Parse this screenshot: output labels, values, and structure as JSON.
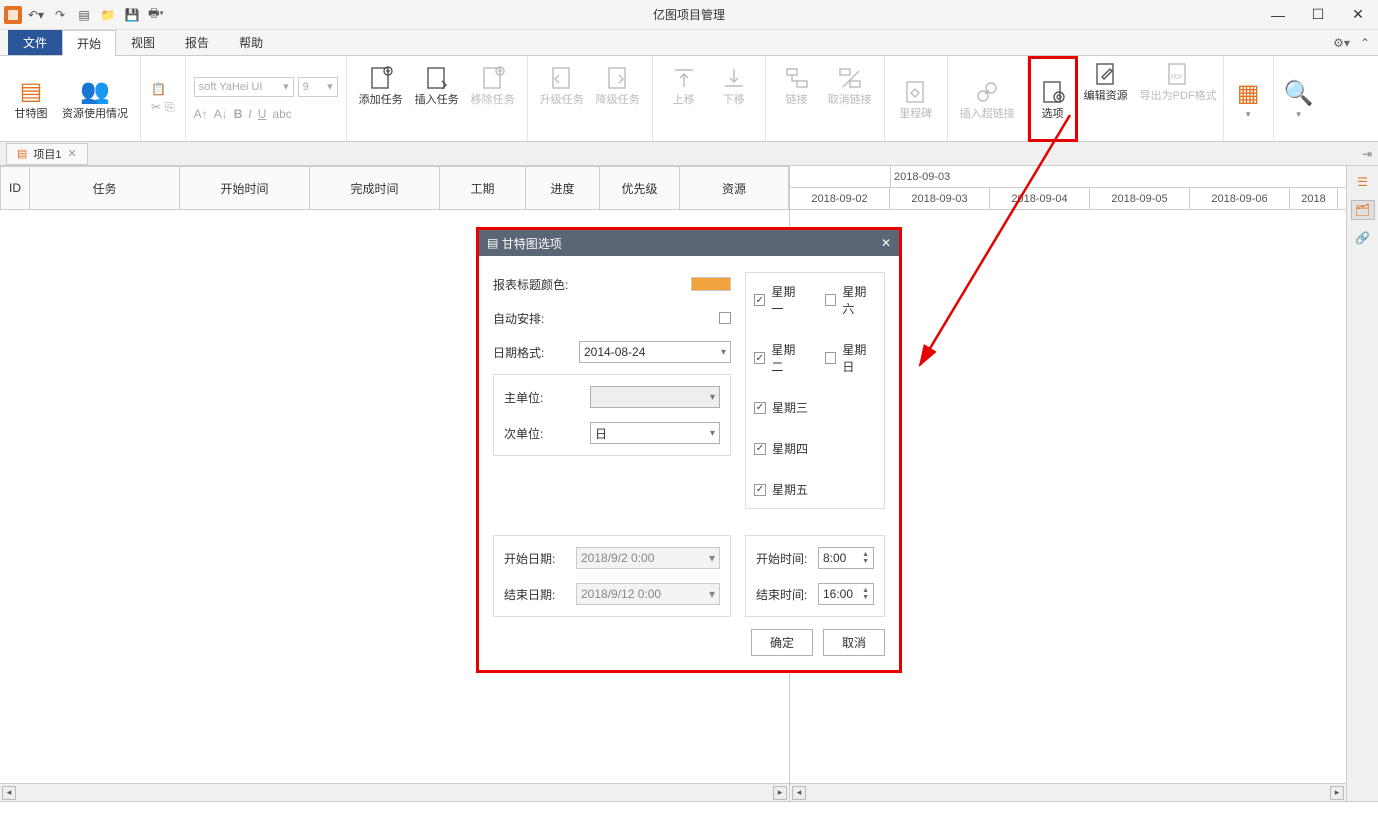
{
  "app": {
    "title": "亿图项目管理"
  },
  "menu": {
    "tabs": [
      "文件",
      "开始",
      "视图",
      "报告",
      "帮助"
    ],
    "activeIndex": 1
  },
  "ribbon": {
    "gantt": "甘特图",
    "resource": "资源使用情况",
    "font_name": "soft YaHei UI",
    "font_size": "9",
    "add_task": "添加任务",
    "insert_task": "插入任务",
    "remove_task": "移除任务",
    "upgrade_task": "升级任务",
    "downgrade_task": "降级任务",
    "move_up": "上移",
    "move_down": "下移",
    "link": "链接",
    "unlink": "取消链接",
    "milestone": "里程碑",
    "hyperlink": "插入超链接",
    "options": "选项",
    "edit_resource": "编辑资源",
    "export_pdf": "导出为PDF格式"
  },
  "doc": {
    "tab": "项目1"
  },
  "table": {
    "cols": [
      "ID",
      "任务",
      "开始时间",
      "完成时间",
      "工期",
      "进度",
      "优先级",
      "资源"
    ]
  },
  "timeline": {
    "top_date": "2018-09-03",
    "dates": [
      "2018-09-02",
      "2018-09-03",
      "2018-09-04",
      "2018-09-05",
      "2018-09-06",
      "2018"
    ]
  },
  "dialog": {
    "title": "甘特图选项",
    "header_color": "报表标题颜色:",
    "auto_arrange": "自动安排:",
    "date_format": "日期格式:",
    "date_format_value": "2014-08-24",
    "major_unit": "主单位:",
    "minor_unit": "次单位:",
    "minor_unit_value": "日",
    "start_date": "开始日期:",
    "end_date": "结束日期:",
    "start_date_value": "2018/9/2 0:00",
    "end_date_value": "2018/9/12 0:00",
    "start_time": "开始时间:",
    "end_time": "结束时间:",
    "start_time_value": "8:00",
    "end_time_value": "16:00",
    "weekdays": [
      {
        "label": "星期一",
        "checked": true
      },
      {
        "label": "星期二",
        "checked": true
      },
      {
        "label": "星期三",
        "checked": true
      },
      {
        "label": "星期四",
        "checked": true
      },
      {
        "label": "星期五",
        "checked": true
      },
      {
        "label": "星期六",
        "checked": false
      },
      {
        "label": "星期日",
        "checked": false
      }
    ],
    "ok": "确定",
    "cancel": "取消"
  }
}
